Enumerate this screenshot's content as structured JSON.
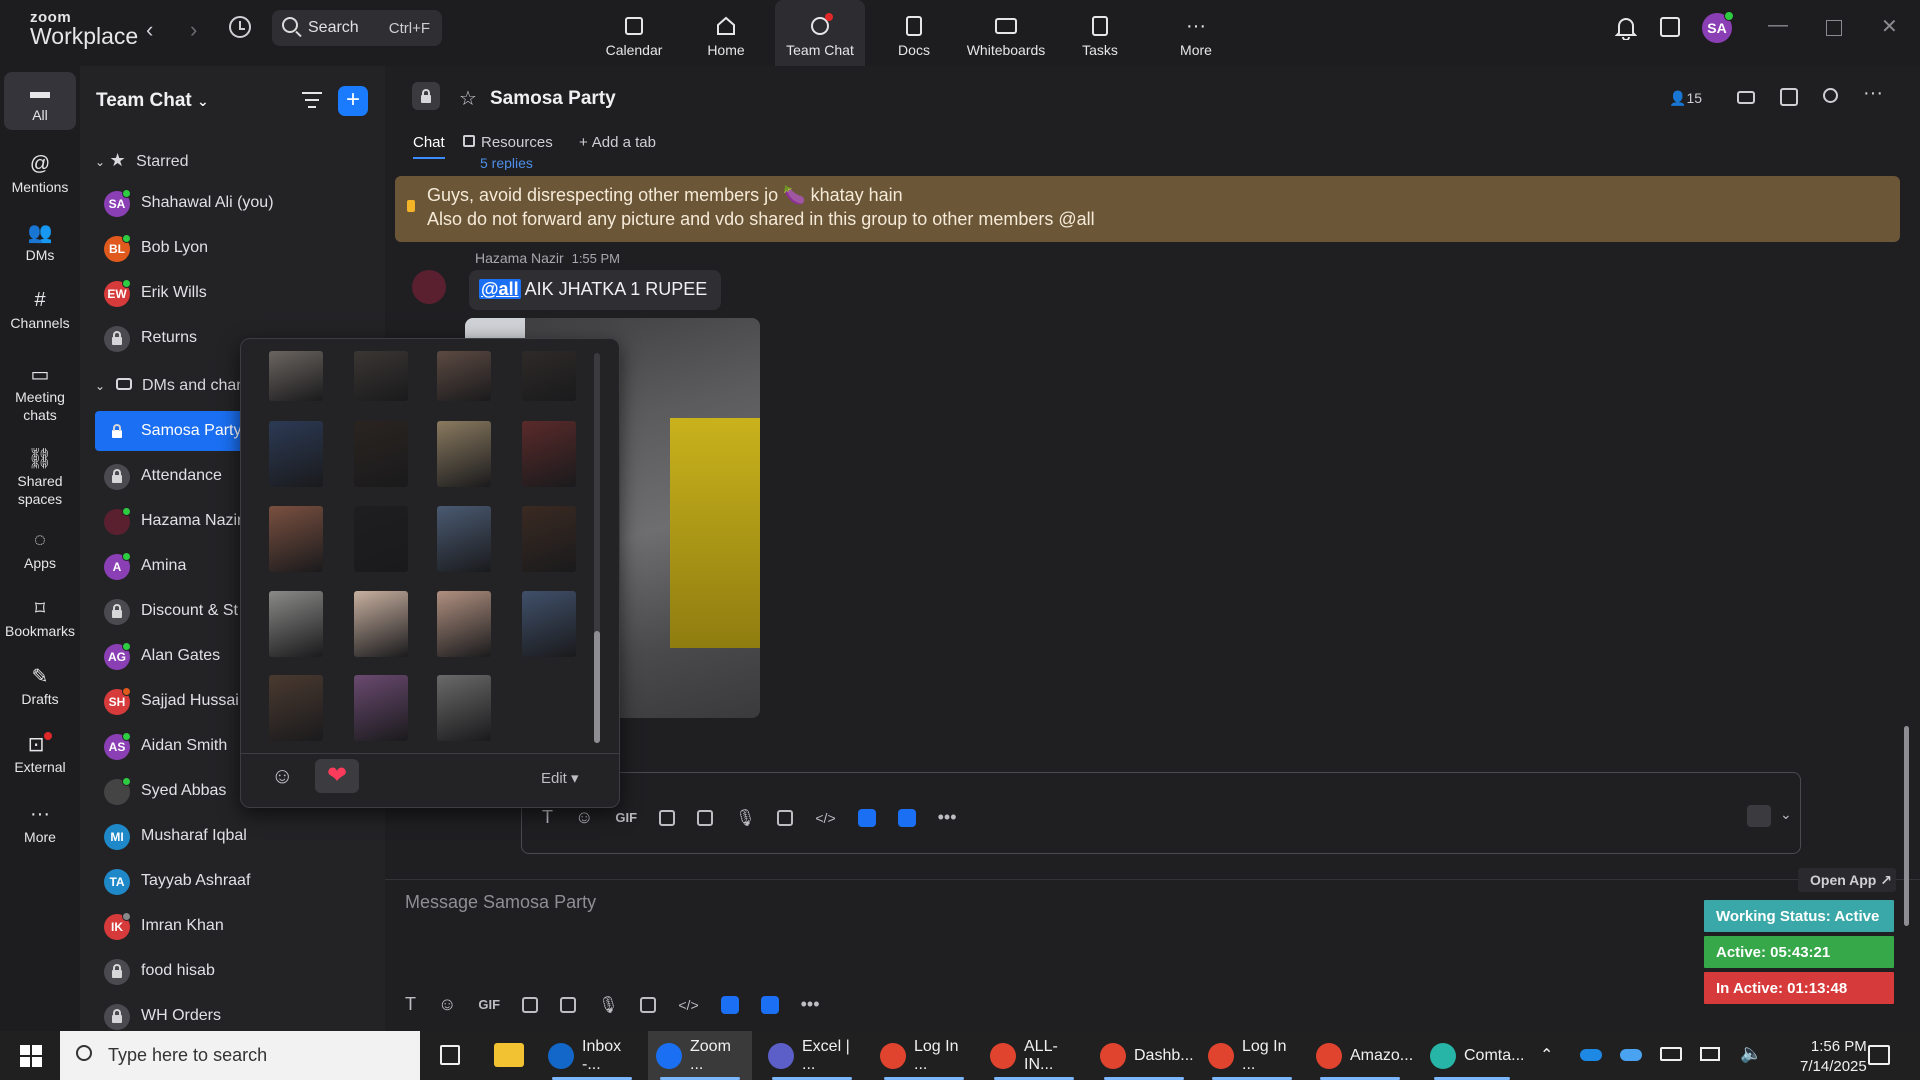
{
  "app": {
    "logo_line1": "zoom",
    "logo_line2": "Workplace",
    "search_label": "Search",
    "search_shortcut": "Ctrl+F",
    "top_nav": [
      {
        "label": "Calendar",
        "icon": "calendar-icon"
      },
      {
        "label": "Home",
        "icon": "home-icon"
      },
      {
        "label": "Team Chat",
        "icon": "team-chat-icon",
        "active": true
      },
      {
        "label": "Docs",
        "icon": "docs-icon"
      },
      {
        "label": "Whiteboards",
        "icon": "whiteboards-icon"
      },
      {
        "label": "Tasks",
        "icon": "tasks-icon"
      },
      {
        "label": "More",
        "icon": "more-icon"
      }
    ],
    "user_initials": "SA"
  },
  "rail": [
    {
      "label": "All",
      "icon": "chat-bubble-icon",
      "active": true
    },
    {
      "label": "Mentions",
      "icon": "at-icon"
    },
    {
      "label": "DMs",
      "icon": "people-icon"
    },
    {
      "label": "Channels",
      "icon": "hash-icon"
    },
    {
      "label": "Meeting chats",
      "icon": "calendar-icon"
    },
    {
      "label": "Shared spaces",
      "icon": "shared-spaces-icon"
    },
    {
      "label": "Apps",
      "icon": "apps-icon"
    },
    {
      "label": "Bookmarks",
      "icon": "bookmark-icon"
    },
    {
      "label": "Drafts",
      "icon": "drafts-icon"
    },
    {
      "label": "External",
      "icon": "external-icon"
    },
    {
      "label": "More",
      "icon": "more-icon"
    }
  ],
  "sidebar": {
    "title": "Team Chat",
    "starred_label": "Starred",
    "dms_label": "DMs and chann",
    "starred": [
      {
        "name": "Shahawal Ali (you)",
        "initials": "SA",
        "color": "#8b3fb5",
        "presence": "#2ecc40"
      },
      {
        "name": "Bob Lyon",
        "initials": "BL",
        "color": "#e05a1e",
        "presence": "#2ecc40"
      },
      {
        "name": "Erik Wills",
        "initials": "EW",
        "color": "#d63a3a",
        "presence": "#2ecc40"
      },
      {
        "name": "Returns",
        "initials": "",
        "color": "#4a4a50",
        "lock": true
      }
    ],
    "items": [
      {
        "name": "Samosa Party",
        "lock": true,
        "selected": true
      },
      {
        "name": "Attendance",
        "lock": true
      },
      {
        "name": "Hazama Nazir",
        "initials": "",
        "color": "#5a2030",
        "presence": "#2ecc40"
      },
      {
        "name": "Amina",
        "initials": "A",
        "color": "#8b3fb5",
        "presence": "#2ecc40"
      },
      {
        "name": "Discount & St",
        "lock": true
      },
      {
        "name": "Alan Gates",
        "initials": "AG",
        "color": "#8b3fb5",
        "presence": "#2ecc40"
      },
      {
        "name": "Sajjad Hussai",
        "initials": "SH",
        "color": "#d63a3a",
        "presence": "#e05a1e"
      },
      {
        "name": "Aidan Smith",
        "initials": "AS",
        "color": "#8b3fb5",
        "presence": "#2ecc40"
      },
      {
        "name": "Syed Abbas",
        "initials": "",
        "color": "#444444",
        "presence": "#2ecc40"
      },
      {
        "name": "Musharaf Iqbal",
        "initials": "MI",
        "color": "#1e88c8",
        "presence": ""
      },
      {
        "name": "Tayyab Ashraaf",
        "initials": "TA",
        "color": "#1e88c8",
        "presence": ""
      },
      {
        "name": "Imran Khan",
        "initials": "IK",
        "color": "#d63a3a",
        "presence": "#888888"
      },
      {
        "name": "food hisab",
        "lock": true
      },
      {
        "name": "WH Orders",
        "lock": true
      }
    ]
  },
  "channel": {
    "name": "Samosa Party",
    "member_count": "15",
    "tabs": [
      {
        "label": "Chat",
        "active": true
      },
      {
        "label": "Resources"
      },
      {
        "label": "Add a tab"
      }
    ],
    "pinned_line1": "Guys, avoid disrespecting other members jo 🍆 khatay hain",
    "pinned_line2": "Also do not forward any picture and vdo shared in this group to other members @all",
    "replies_text": "5 replies",
    "message": {
      "sender": "Hazama Nazir",
      "time": "1:55 PM",
      "mention": "@all",
      "text": " AIK JHATKA 1 RUPEE"
    },
    "composer_placeholder": "Message Samosa Party"
  },
  "popover": {
    "edit_label": "Edit",
    "thumbs": [
      [
        "#6b6560",
        "#3a3633",
        "#5c4a42",
        "#2e2a28"
      ],
      [
        "#2c3a55",
        "#2a2420",
        "#8a7a60",
        "#5a2a2a"
      ],
      [
        "#7a5040",
        "#1e1e20",
        "#4a5a72",
        "#3a2a22"
      ],
      [
        "#8a8a88",
        "#c8b0a0",
        "#b09080",
        "#40506a"
      ],
      [
        "#4a3a30",
        "#6a4a70",
        "#6a6a6a"
      ]
    ]
  },
  "status_widget": {
    "open_app": "Open App ↗",
    "working": "Working Status: Active",
    "active": "Active: 05:43:21",
    "inactive": "In Active: 01:13:48"
  },
  "taskbar": {
    "search_placeholder": "Type here to search",
    "items": [
      {
        "label": "Inbox -...",
        "color": "#1267c8"
      },
      {
        "label": "Zoom ...",
        "color": "#1b6ff2",
        "active": true
      },
      {
        "label": "Excel | ...",
        "color": "#5b5fc7"
      },
      {
        "label": "Log In ...",
        "color": "#e0442e"
      },
      {
        "label": "ALL-IN...",
        "color": "#e0442e"
      },
      {
        "label": "Dashb...",
        "color": "#e0442e"
      },
      {
        "label": "Log In ...",
        "color": "#e0442e"
      },
      {
        "label": "Amazo...",
        "color": "#e0442e"
      },
      {
        "label": "Comta...",
        "color": "#27b5a8"
      }
    ],
    "time": "1:56 PM",
    "date": "7/14/2025"
  }
}
